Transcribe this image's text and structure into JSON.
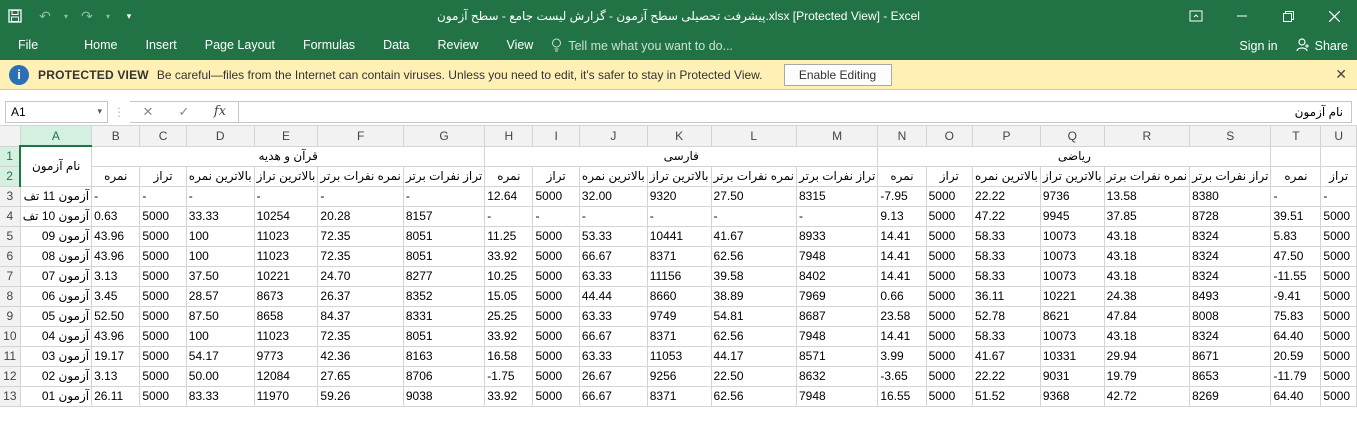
{
  "window": {
    "title": "پیشرفت تحصیلی سطح آزمون - گزارش لیست جامع - سطح آزمون.xlsx  [Protected View] - Excel",
    "qat_icons": [
      "save-icon",
      "undo-icon",
      "redo-icon",
      "customize-qat-icon"
    ],
    "controls": [
      "ribbon-display-icon",
      "minimize-icon",
      "restore-icon",
      "close-icon"
    ]
  },
  "ribbon": {
    "tabs": [
      "File",
      "Home",
      "Insert",
      "Page Layout",
      "Formulas",
      "Data",
      "Review",
      "View"
    ],
    "tell_me": "Tell me what you want to do...",
    "sign_in": "Sign in",
    "share": "Share"
  },
  "protected_view": {
    "title": "PROTECTED VIEW",
    "message": "Be careful—files from the Internet can contain viruses. Unless you need to edit, it's safer to stay in Protected View.",
    "button": "Enable Editing",
    "color": "#fff1b5"
  },
  "formula_bar": {
    "name_box": "A1",
    "value": "نام آزمون"
  },
  "sheet": {
    "columns": [
      "A",
      "B",
      "C",
      "D",
      "E",
      "F",
      "G",
      "H",
      "I",
      "J",
      "K",
      "L",
      "M",
      "N",
      "O",
      "P",
      "Q",
      "R",
      "S",
      "T",
      "U"
    ],
    "selected_cell": "A1",
    "a1_text": "نام آزمون",
    "group_headers": [
      "قرآن و هدیه",
      "فارسی",
      "ریاضی"
    ],
    "sub_headers": [
      "نمره",
      "تراز",
      "بالاترین نمره",
      "بالاترین تراز",
      "نمره نفرات برتر",
      "تراز نفرات برتر",
      "نمره",
      "تراز",
      "بالاترین نمره",
      "بالاترین تراز",
      "نمره نفرات برتر",
      "تراز نفرات برتر",
      "نمره",
      "تراز",
      "بالاترین نمره",
      "بالاترین تراز",
      "نمره نفرات برتر",
      "تراز نفرات برتر",
      "نمره",
      "تراز"
    ],
    "rows": [
      {
        "n": "3",
        "label": "آزمون 11 تف",
        "cells": [
          "-",
          "-",
          "-",
          "-",
          "-",
          "-",
          "12.64",
          "5000",
          "32.00",
          "9320",
          "27.50",
          "8315",
          "-7.95",
          "5000",
          "22.22",
          "9736",
          "13.58",
          "8380",
          "-",
          "-"
        ]
      },
      {
        "n": "4",
        "label": "آزمون 10 تف",
        "cells": [
          "0.63",
          "5000",
          "33.33",
          "10254",
          "20.28",
          "8157",
          "-",
          "-",
          "-",
          "-",
          "-",
          "-",
          "9.13",
          "5000",
          "47.22",
          "9945",
          "37.85",
          "8728",
          "39.51",
          "5000"
        ]
      },
      {
        "n": "5",
        "label": "آزمون 09",
        "cells": [
          "43.96",
          "5000",
          "100",
          "11023",
          "72.35",
          "8051",
          "11.25",
          "5000",
          "53.33",
          "10441",
          "41.67",
          "8933",
          "14.41",
          "5000",
          "58.33",
          "10073",
          "43.18",
          "8324",
          "5.83",
          "5000"
        ]
      },
      {
        "n": "6",
        "label": "آزمون 08",
        "cells": [
          "43.96",
          "5000",
          "100",
          "11023",
          "72.35",
          "8051",
          "33.92",
          "5000",
          "66.67",
          "8371",
          "62.56",
          "7948",
          "14.41",
          "5000",
          "58.33",
          "10073",
          "43.18",
          "8324",
          "47.50",
          "5000"
        ]
      },
      {
        "n": "7",
        "label": "آزمون 07",
        "cells": [
          "3.13",
          "5000",
          "37.50",
          "10221",
          "24.70",
          "8277",
          "10.25",
          "5000",
          "63.33",
          "11156",
          "39.58",
          "8402",
          "14.41",
          "5000",
          "58.33",
          "10073",
          "43.18",
          "8324",
          "-11.55",
          "5000"
        ]
      },
      {
        "n": "8",
        "label": "آزمون 06",
        "cells": [
          "3.45",
          "5000",
          "28.57",
          "8673",
          "26.37",
          "8352",
          "15.05",
          "5000",
          "44.44",
          "8660",
          "38.89",
          "7969",
          "0.66",
          "5000",
          "36.11",
          "10221",
          "24.38",
          "8493",
          "-9.41",
          "5000"
        ]
      },
      {
        "n": "9",
        "label": "آزمون 05",
        "cells": [
          "52.50",
          "5000",
          "87.50",
          "8658",
          "84.37",
          "8331",
          "25.25",
          "5000",
          "63.33",
          "9749",
          "54.81",
          "8687",
          "23.58",
          "5000",
          "52.78",
          "8621",
          "47.84",
          "8008",
          "75.83",
          "5000"
        ]
      },
      {
        "n": "10",
        "label": "آزمون 04",
        "cells": [
          "43.96",
          "5000",
          "100",
          "11023",
          "72.35",
          "8051",
          "33.92",
          "5000",
          "66.67",
          "8371",
          "62.56",
          "7948",
          "14.41",
          "5000",
          "58.33",
          "10073",
          "43.18",
          "8324",
          "64.40",
          "5000"
        ]
      },
      {
        "n": "11",
        "label": "آزمون 03",
        "cells": [
          "19.17",
          "5000",
          "54.17",
          "9773",
          "42.36",
          "8163",
          "16.58",
          "5000",
          "63.33",
          "11053",
          "44.17",
          "8571",
          "3.99",
          "5000",
          "41.67",
          "10331",
          "29.94",
          "8671",
          "20.59",
          "5000"
        ]
      },
      {
        "n": "12",
        "label": "آزمون 02",
        "cells": [
          "3.13",
          "5000",
          "50.00",
          "12084",
          "27.65",
          "8706",
          "-1.75",
          "5000",
          "26.67",
          "9256",
          "22.50",
          "8632",
          "-3.65",
          "5000",
          "22.22",
          "9031",
          "19.79",
          "8653",
          "-11.79",
          "5000"
        ]
      },
      {
        "n": "13",
        "label": "آزمون 01",
        "cells": [
          "26.11",
          "5000",
          "83.33",
          "11970",
          "59.26",
          "9038",
          "33.92",
          "5000",
          "66.67",
          "8371",
          "62.56",
          "7948",
          "16.55",
          "5000",
          "51.52",
          "9368",
          "42.72",
          "8269",
          "64.40",
          "5000"
        ]
      }
    ]
  }
}
